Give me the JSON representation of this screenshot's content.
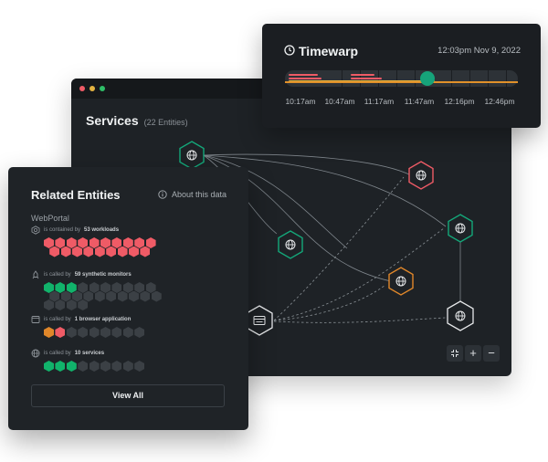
{
  "colors": {
    "red": "#ef5b66",
    "green": "#11b36b",
    "orange": "#e0872a",
    "gray": "#3b4045",
    "teal": "#1a9d77",
    "white": "#e6e8ea"
  },
  "services": {
    "title": "Services",
    "entity_count": "(22 Entities)",
    "window_dots": [
      "#ef5b66",
      "#e3b341",
      "#2ebd67"
    ],
    "nodes": [
      {
        "name": "service-node-top",
        "icon": "globe-icon",
        "status": "green"
      },
      {
        "name": "service-node-center",
        "icon": "globe-icon",
        "status": "green"
      },
      {
        "name": "service-node-right-red",
        "icon": "globe-icon",
        "status": "red"
      },
      {
        "name": "service-node-right-green",
        "icon": "globe-icon",
        "status": "green"
      },
      {
        "name": "service-node-orange",
        "icon": "globe-icon",
        "status": "orange"
      },
      {
        "name": "service-node-bottom-right",
        "icon": "globe-icon",
        "status": "white"
      },
      {
        "name": "browser-app-node",
        "icon": "browser-icon",
        "status": "white"
      }
    ],
    "zoom": {
      "fit": "collapse-icon",
      "plus": "+",
      "minus": "−"
    }
  },
  "timewarp": {
    "title": "Timewarp",
    "icon": "clock-icon",
    "date": "12:03pm  Nov 9, 2022",
    "ticks": [
      "10:17am",
      "10:47am",
      "11:17am",
      "11:47am",
      "12:16pm",
      "12:46pm"
    ]
  },
  "related": {
    "title": "Related Entities",
    "about": "About this data",
    "entity": "WebPortal",
    "rows": [
      {
        "icon": "workload-icon",
        "prefix": "is contained by",
        "bold": "53 workloads",
        "red": 19,
        "green": 0,
        "orange": 0,
        "gray": 0
      },
      {
        "icon": "synthetic-monitor-icon",
        "prefix": "is called by",
        "bold": "59 synthetic monitors",
        "red": 0,
        "green": 3,
        "orange": 0,
        "gray": 21
      },
      {
        "icon": "browser-icon",
        "prefix": "is called by",
        "bold": "1 browser application",
        "red": 1,
        "green": 0,
        "orange": 1,
        "gray": 7
      },
      {
        "icon": "globe-icon",
        "prefix": "is called by",
        "bold": "10 services",
        "red": 0,
        "green": 3,
        "orange": 0,
        "gray": 6
      }
    ],
    "view_all": "View All"
  }
}
